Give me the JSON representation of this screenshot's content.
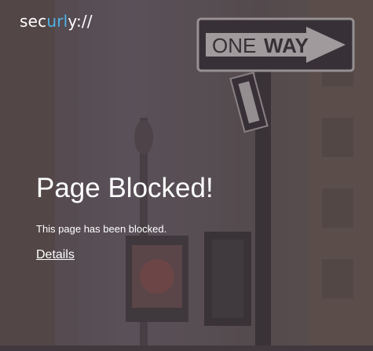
{
  "brand": {
    "logo_part1": "sec",
    "logo_part2": "url",
    "logo_part3": "y://",
    "accent_color": "#4fb3e8"
  },
  "sign": {
    "text_left": "ONE",
    "text_right": "WAY"
  },
  "main": {
    "title": "Page Blocked!",
    "message": "This page has been blocked.",
    "details_link": "Details"
  }
}
